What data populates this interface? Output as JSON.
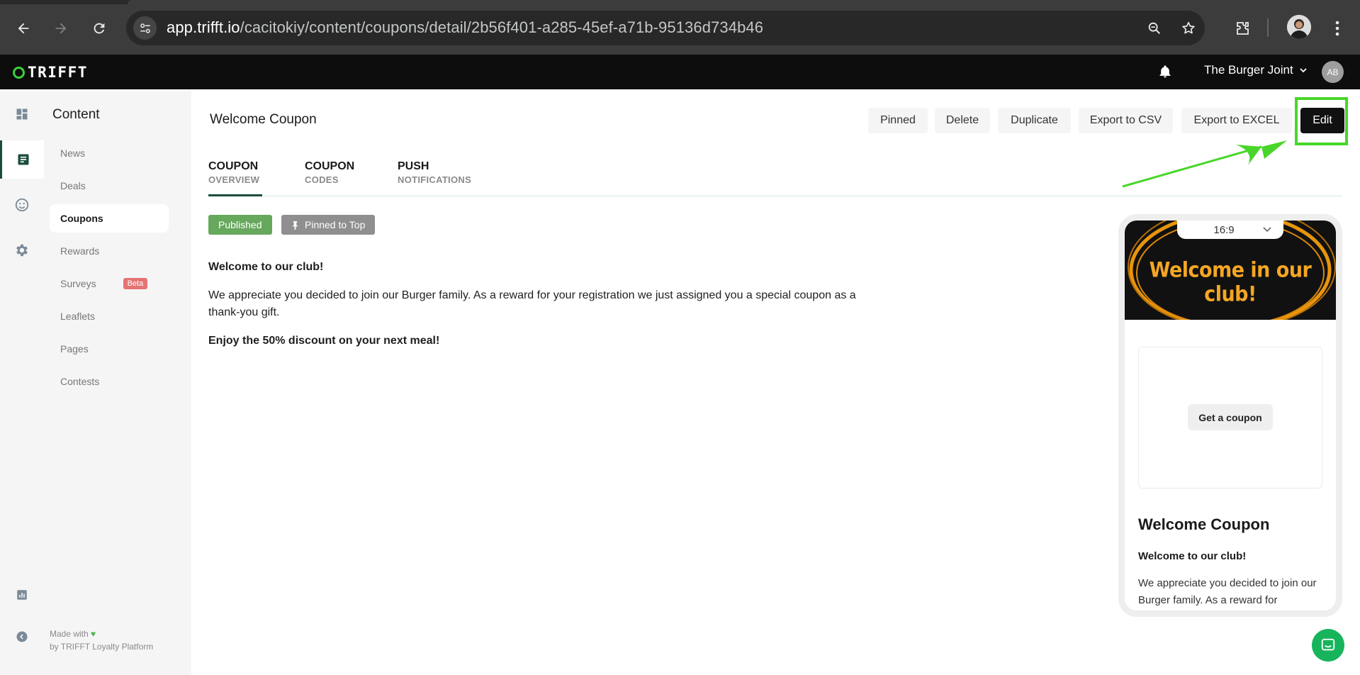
{
  "browser": {
    "url_host": "app.trifft.io",
    "url_path": "/cacitokiy/content/coupons/detail/2b56f401-a285-45ef-a71b-95136d734b46"
  },
  "header": {
    "logo_text": "TRIFFT",
    "store_name": "The Burger Joint",
    "avatar_initials": "AB"
  },
  "sidebar": {
    "title": "Content",
    "items": [
      {
        "label": "News"
      },
      {
        "label": "Deals"
      },
      {
        "label": "Coupons",
        "active": true
      },
      {
        "label": "Rewards"
      },
      {
        "label": "Surveys",
        "badge": "Beta"
      },
      {
        "label": "Leaflets"
      },
      {
        "label": "Pages"
      },
      {
        "label": "Contests"
      }
    ],
    "made_with": "Made with",
    "by_line": "by TRIFFT Loyalty Platform"
  },
  "main": {
    "title": "Welcome Coupon",
    "actions": {
      "pinned": "Pinned",
      "delete": "Delete",
      "duplicate": "Duplicate",
      "export_csv": "Export to CSV",
      "export_excel": "Export to EXCEL",
      "edit": "Edit"
    },
    "tabs": [
      {
        "line1": "COUPON",
        "line2": "OVERVIEW",
        "active": true
      },
      {
        "line1": "COUPON",
        "line2": "CODES"
      },
      {
        "line1": "PUSH",
        "line2": "NOTIFICATIONS"
      }
    ],
    "badges": {
      "published": "Published",
      "pinned_top": "Pinned to Top"
    },
    "content": {
      "heading": "Welcome to our club!",
      "body": "We appreciate you decided to join our Burger family. As a reward for your registration we just assigned you a special coupon as a thank-you gift.",
      "cta": "Enjoy the 50% discount on your next meal!"
    }
  },
  "preview": {
    "aspect_ratio": "16:9",
    "banner_text": "Welcome in our club!",
    "get_coupon": "Get a coupon",
    "title": "Welcome Coupon",
    "subtitle": "Welcome to our club!",
    "body": "We appreciate you decided to join our Burger family. As a reward for"
  },
  "colors": {
    "brand_green": "#3ad13a",
    "highlight_green": "#49d62a",
    "published_green": "#66a85c",
    "dark": "#0d0d0d"
  }
}
